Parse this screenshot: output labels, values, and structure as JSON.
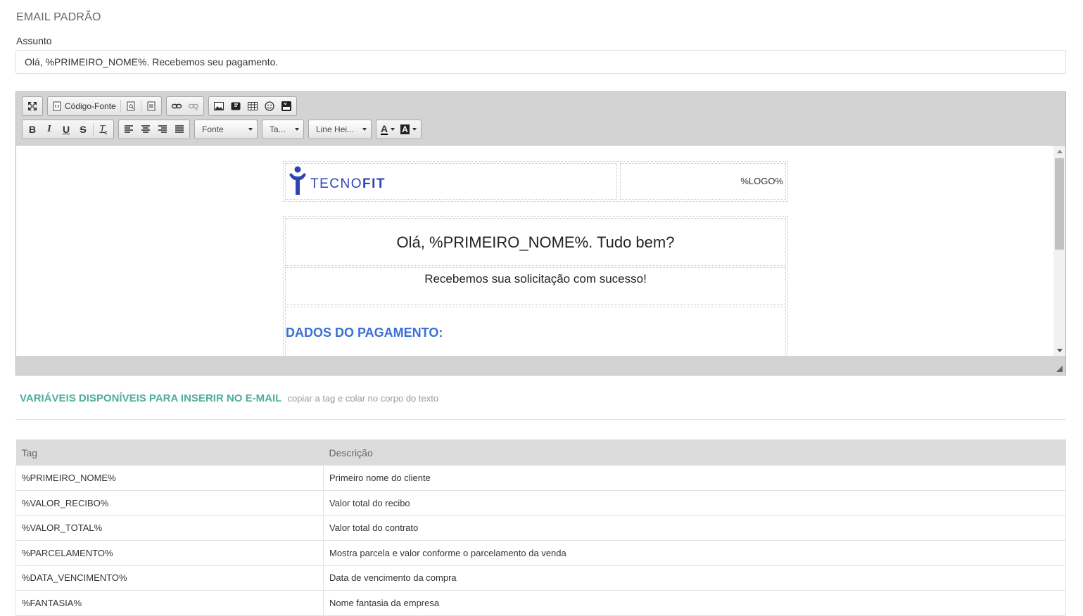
{
  "section_title": "EMAIL PADRÃO",
  "subject": {
    "label": "Assunto",
    "value": "Olá, %PRIMEIRO_NOME%. Recebemos seu pagamento."
  },
  "toolbar": {
    "source_label": "Código-Fonte",
    "font_combo": "Fonte",
    "size_combo": "Ta...",
    "lineheight_combo": "Line Hei...",
    "icons": [
      "maximize-icon",
      "source-icon",
      "preview-icon",
      "template-icon",
      "link-icon",
      "unlink-icon",
      "image-icon",
      "flash-icon",
      "table-icon",
      "smiley-icon",
      "youtube-icon",
      "bold-icon",
      "italic-icon",
      "underline-icon",
      "strike-icon",
      "remove-format-icon",
      "align-left-icon",
      "align-center-icon",
      "align-right-icon",
      "align-justify-icon",
      "text-color-icon",
      "bg-color-icon"
    ],
    "bold": "B",
    "italic": "I",
    "underline": "U",
    "strike": "S",
    "remove_format": "T",
    "text_color": "A",
    "bg_color": "A"
  },
  "email": {
    "logo_text_light": "TECNO",
    "logo_text_bold": "FIT",
    "logo_placeholder": "%LOGO%",
    "greeting": "Olá, %PRIMEIRO_NOME%. Tudo bem?",
    "received": "Recebemos sua solicitação com sucesso!",
    "payment_title": "DADOS DO PAGAMENTO:"
  },
  "variables": {
    "title": "VARIÁVEIS DISPONÍVEIS PARA INSERIR NO E-MAIL",
    "hint": "copiar a tag e colar no corpo do texto",
    "columns": [
      "Tag",
      "Descrição"
    ],
    "rows": [
      [
        "%PRIMEIRO_NOME%",
        "Primeiro nome do cliente"
      ],
      [
        "%VALOR_RECIBO%",
        "Valor total do recibo"
      ],
      [
        "%VALOR_TOTAL%",
        "Valor total do contrato"
      ],
      [
        "%PARCELAMENTO%",
        "Mostra parcela e valor conforme o parcelamento da venda"
      ],
      [
        "%DATA_VENCIMENTO%",
        "Data de vencimento da compra"
      ],
      [
        "%FANTASIA%",
        "Nome fantasia da empresa"
      ]
    ]
  },
  "colors": {
    "accent": "#4fad9b",
    "payment_title": "#3a6fd6",
    "logo": "#2e44b3"
  }
}
